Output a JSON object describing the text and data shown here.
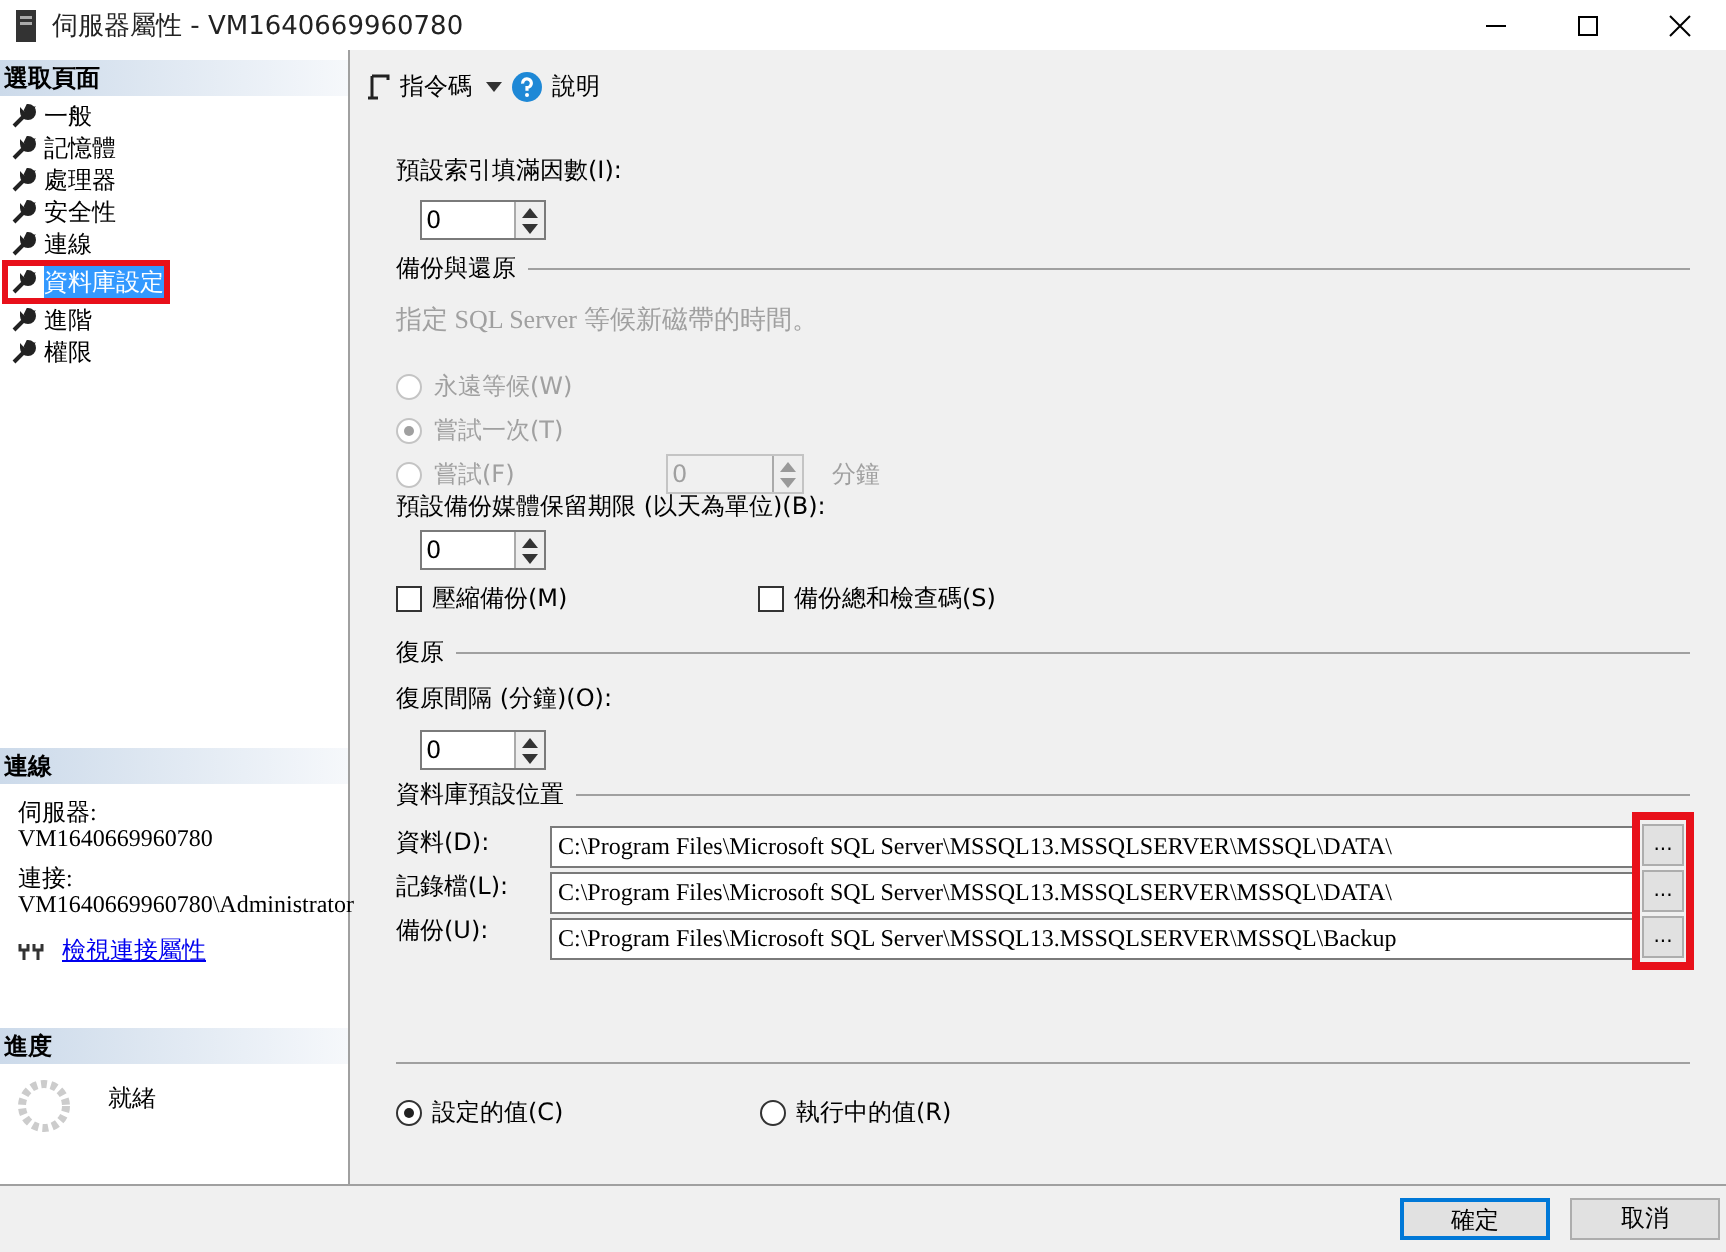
{
  "window": {
    "title": "伺服器屬性 - VM1640669960780"
  },
  "sidebar": {
    "heading": "選取頁面",
    "pages": [
      {
        "label": "一般",
        "selected": false,
        "annotated": false
      },
      {
        "label": "記憶體",
        "selected": false,
        "annotated": false
      },
      {
        "label": "處理器",
        "selected": false,
        "annotated": false
      },
      {
        "label": "安全性",
        "selected": false,
        "annotated": false
      },
      {
        "label": "連線",
        "selected": false,
        "annotated": false
      },
      {
        "label": "資料庫設定",
        "selected": true,
        "annotated": true
      },
      {
        "label": "進階",
        "selected": false,
        "annotated": false
      },
      {
        "label": "權限",
        "selected": false,
        "annotated": false
      }
    ]
  },
  "connection": {
    "heading": "連線",
    "server_label": "伺服器:",
    "server": "VM1640669960780",
    "connect_label": "連接:",
    "connect": "VM1640669960780\\Administrator",
    "link": "檢視連接屬性"
  },
  "progress": {
    "heading": "進度",
    "status": "就緒"
  },
  "toolbar": {
    "script": "指令碼",
    "help": "說明"
  },
  "fill_factor": {
    "label": "預設索引填滿因數(I):",
    "value": "0"
  },
  "backup": {
    "heading": "備份與還原",
    "description": "指定 SQL Server 等候新磁帶的時間。",
    "options": [
      {
        "label": "永遠等候(W)",
        "selected": false,
        "disabled": true
      },
      {
        "label": "嘗試一次(T)",
        "selected": true,
        "disabled": true
      },
      {
        "label": "嘗試(F)",
        "selected": false,
        "disabled": true,
        "minutes": "0",
        "unit": "分鐘"
      }
    ],
    "retention_label": "預設備份媒體保留期限 (以天為單位)(B):",
    "retention_value": "0",
    "checkboxes": [
      {
        "label": "壓縮備份(M)",
        "checked": false
      },
      {
        "label": "備份總和檢查碼(S)",
        "checked": false
      }
    ]
  },
  "recovery": {
    "heading": "復原",
    "interval_label": "復原間隔 (分鐘)(O):",
    "interval_value": "0"
  },
  "locations": {
    "heading": "資料庫預設位置",
    "annotated": true,
    "rows": [
      {
        "label": "資料(D):",
        "path": "C:\\Program Files\\Microsoft SQL Server\\MSSQL13.MSSQLSERVER\\MSSQL\\DATA\\",
        "browse": "..."
      },
      {
        "label": "記錄檔(L):",
        "path": "C:\\Program Files\\Microsoft SQL Server\\MSSQL13.MSSQLSERVER\\MSSQL\\DATA\\",
        "browse": "..."
      },
      {
        "label": "備份(U):",
        "path": "C:\\Program Files\\Microsoft SQL Server\\MSSQL13.MSSQLSERVER\\MSSQL\\Backup",
        "browse": "..."
      }
    ]
  },
  "value_mode": [
    {
      "label": "設定的值(C)",
      "selected": true
    },
    {
      "label": "執行中的值(R)",
      "selected": false
    }
  ],
  "buttons": [
    {
      "label": "確定",
      "default": true
    },
    {
      "label": "取消",
      "default": false
    }
  ]
}
